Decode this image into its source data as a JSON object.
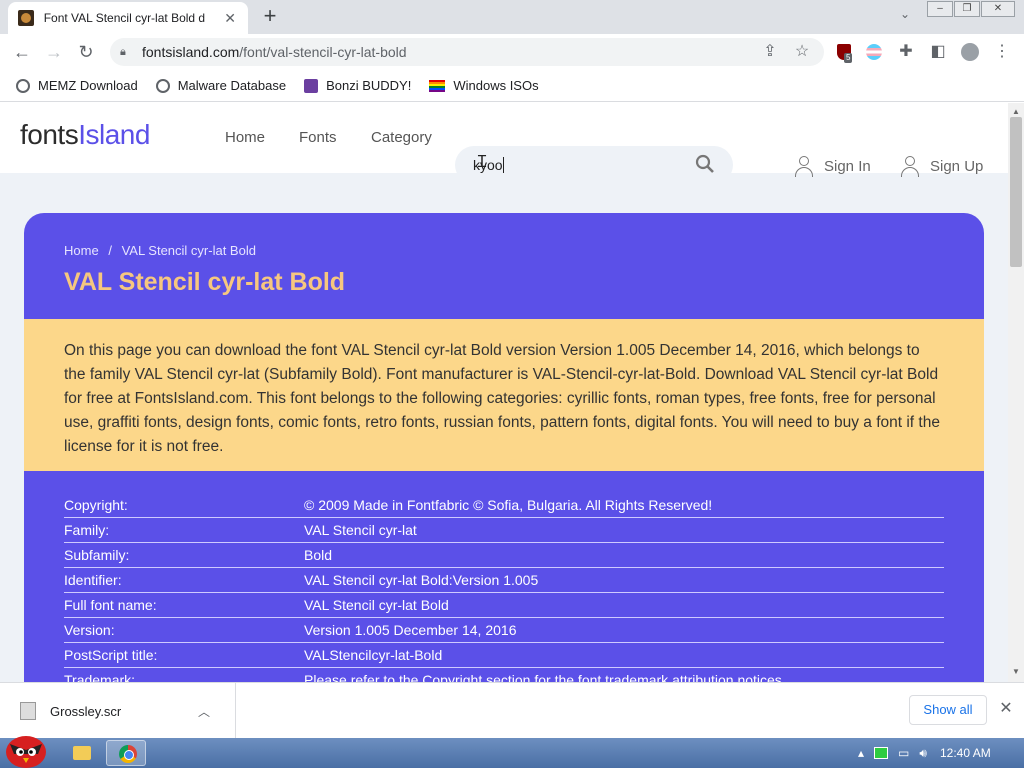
{
  "browser": {
    "tab_title": "Font VAL Stencil cyr-lat Bold d",
    "tab_close": "✕",
    "new_tab": "+",
    "url_host": "fontsisland.com",
    "url_path": "/font/val-stencil-cyr-lat-bold",
    "extension_badge": "5",
    "bookmarks": [
      "MEMZ Download",
      "Malware Database",
      "Bonzi BUDDY!",
      "Windows ISOs"
    ]
  },
  "site": {
    "logo_a": "fonts",
    "logo_b": "Island",
    "nav": [
      "Home",
      "Fonts",
      "Category"
    ],
    "search_value": "kyoo",
    "sign_in": "Sign In",
    "sign_up": "Sign Up"
  },
  "font_page": {
    "breadcrumb_home": "Home",
    "breadcrumb_sep": "/",
    "breadcrumb_current": "VAL Stencil cyr-lat Bold",
    "title": "VAL Stencil cyr-lat Bold",
    "description": "On this page you can download the font VAL Stencil cyr-lat Bold version Version 1.005 December 14, 2016, which belongs to the family VAL Stencil cyr-lat (Subfamily Bold). Font manufacturer is VAL-Stencil-cyr-lat-Bold. Download VAL Stencil cyr-lat Bold for free at FontsIsland.com. This font belongs to the following categories: cyrillic fonts, roman types, free fonts, free for personal use, graffiti fonts, design fonts, comic fonts, retro fonts, russian fonts, pattern fonts, digital fonts. You will need to buy a font if the license for it is not free.",
    "specs": [
      {
        "key": "Copyright:",
        "value": "© 2009 Made in Fontfabric © Sofia, Bulgaria. All Rights Reserved!"
      },
      {
        "key": "Family:",
        "value": "VAL Stencil cyr-lat"
      },
      {
        "key": "Subfamily:",
        "value": "Bold"
      },
      {
        "key": "Identifier:",
        "value": "VAL Stencil cyr-lat Bold:Version 1.005"
      },
      {
        "key": "Full font name:",
        "value": "VAL Stencil cyr-lat Bold"
      },
      {
        "key": "Version:",
        "value": "Version 1.005 December 14, 2016"
      },
      {
        "key": "PostScript title:",
        "value": "VALStencilcyr-lat-Bold"
      },
      {
        "key": "Trademark:",
        "value": "Please refer to the Copyright section for the font trademark attribution notices."
      }
    ]
  },
  "downloads": {
    "file_name": "Grossley.scr",
    "show_all": "Show all"
  },
  "taskbar": {
    "clock": "12:40 AM"
  },
  "colors": {
    "brand_purple": "#5b50e8",
    "title_gold": "#f6c77f",
    "desc_bg": "#fcd78a"
  }
}
